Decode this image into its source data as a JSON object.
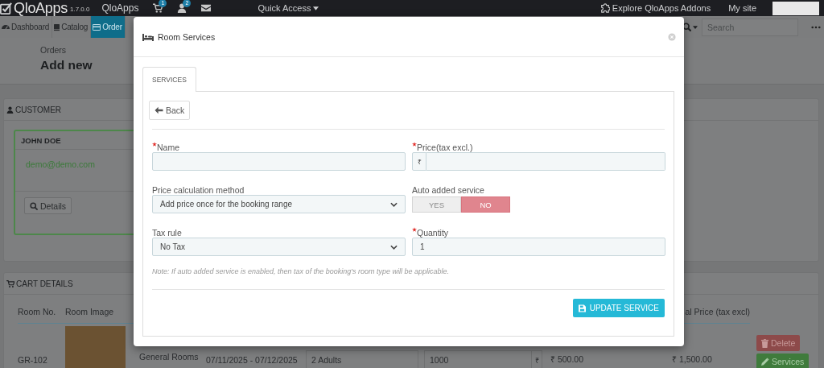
{
  "topbar": {
    "logo": "QloApps",
    "version": "1.7.0.0",
    "shop_link": "QloApps",
    "notifications": [
      {
        "kind": "cart",
        "count": "1"
      },
      {
        "kind": "customer",
        "count": "2"
      },
      {
        "kind": "message"
      }
    ],
    "quick_access": "Quick Access",
    "addons": "Explore QloApps Addons",
    "my_site": "My site"
  },
  "nav": {
    "tabs": [
      {
        "kind": "dashboard",
        "label": "Dashboard",
        "selected": false
      },
      {
        "kind": "catalog",
        "label": "Catalog",
        "selected": false
      },
      {
        "kind": "orders",
        "label": "Order",
        "selected": true
      }
    ],
    "search": {
      "placeholder": "Search"
    }
  },
  "header": {
    "breadcrumb": "Orders",
    "title": "Add new"
  },
  "customer_panel": {
    "title": "CUSTOMER",
    "name": "JOHN DOE",
    "email": "demo@demo.com",
    "details_button": "Details"
  },
  "cart_panel": {
    "title": "CART DETAILS",
    "columns": [
      "Room No.",
      "Room Image",
      "al Price (tax excl)"
    ],
    "row": {
      "room_no": "GR-102",
      "room_type": "General Rooms",
      "dates": "07/11/2025 - 07/12/2025",
      "occupancy": "2 Adults",
      "price": "1000",
      "currency": "₹",
      "unit_price": "₹ 500.00",
      "total": "₹ 1,500.00",
      "delete_button": "Delete",
      "services_button": "Services"
    }
  },
  "modal": {
    "title": "Room Services",
    "tabs": [
      {
        "label": "SERVICES",
        "selected": true
      }
    ],
    "back_button": "Back",
    "fields": [
      {
        "kind": "text",
        "label": "Name",
        "required": true
      },
      {
        "kind": "price",
        "label": "Price(tax excl.)",
        "required": true,
        "prefix": "₹"
      },
      {
        "kind": "select",
        "label": "Price calculation method",
        "required": false,
        "value": "Add price once for the booking range"
      },
      {
        "kind": "toggle",
        "label": "Auto added service",
        "required": false,
        "options": [
          {
            "label": "YES",
            "selected": false
          },
          {
            "label": "NO",
            "selected": true
          }
        ]
      },
      {
        "kind": "select",
        "label": "Tax rule",
        "required": false,
        "value": "No Tax"
      },
      {
        "kind": "text",
        "label": "Quantity",
        "required": true,
        "value": "1"
      }
    ],
    "note": "Note: If auto added service is enabled, then tax of the booking's room type will be applicable.",
    "submit_button": "UPDATE SERVICE"
  }
}
